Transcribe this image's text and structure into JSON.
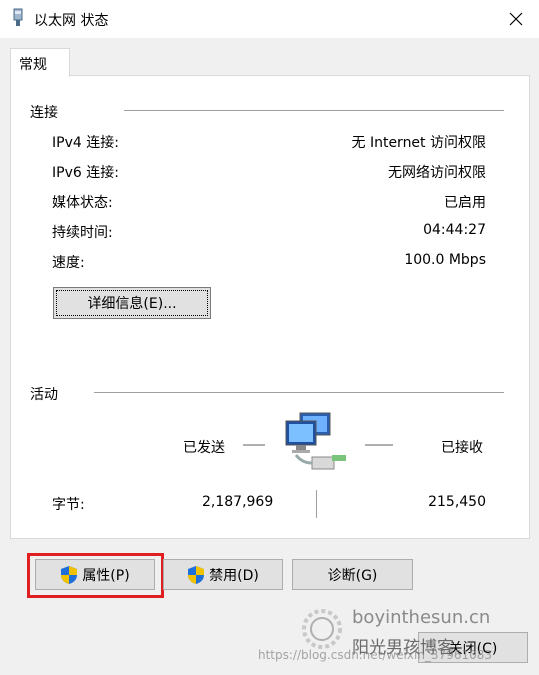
{
  "window": {
    "title": "以太网 状态",
    "close_glyph": "✕"
  },
  "tabs": [
    {
      "label": "常规"
    }
  ],
  "connection": {
    "group_label": "连接",
    "rows": [
      {
        "label": "IPv4 连接:",
        "value": "无 Internet 访问权限"
      },
      {
        "label": "IPv6 连接:",
        "value": "无网络访问权限"
      },
      {
        "label": "媒体状态:",
        "value": "已启用"
      },
      {
        "label": "持续时间:",
        "value": "04:44:27"
      },
      {
        "label": "速度:",
        "value": "100.0 Mbps"
      }
    ],
    "details_button": "详细信息(E)..."
  },
  "activity": {
    "group_label": "活动",
    "sent_label": "已发送",
    "received_label": "已接收",
    "bytes_label": "字节:",
    "bytes_sent": "2,187,969",
    "bytes_received": "215,450"
  },
  "buttons": {
    "properties": "属性(P)",
    "disable": "禁用(D)",
    "diagnose": "诊断(G)",
    "close": "关闭(C)"
  },
  "watermark": {
    "site": "boyinthesun.cn",
    "brand": "阳光男孩博客",
    "url": "https://blog.csdn.net/weixin_37961083"
  },
  "colors": {
    "highlight": "#e02020",
    "shield_blue": "#1e6fd9",
    "shield_yellow": "#f2c200"
  }
}
